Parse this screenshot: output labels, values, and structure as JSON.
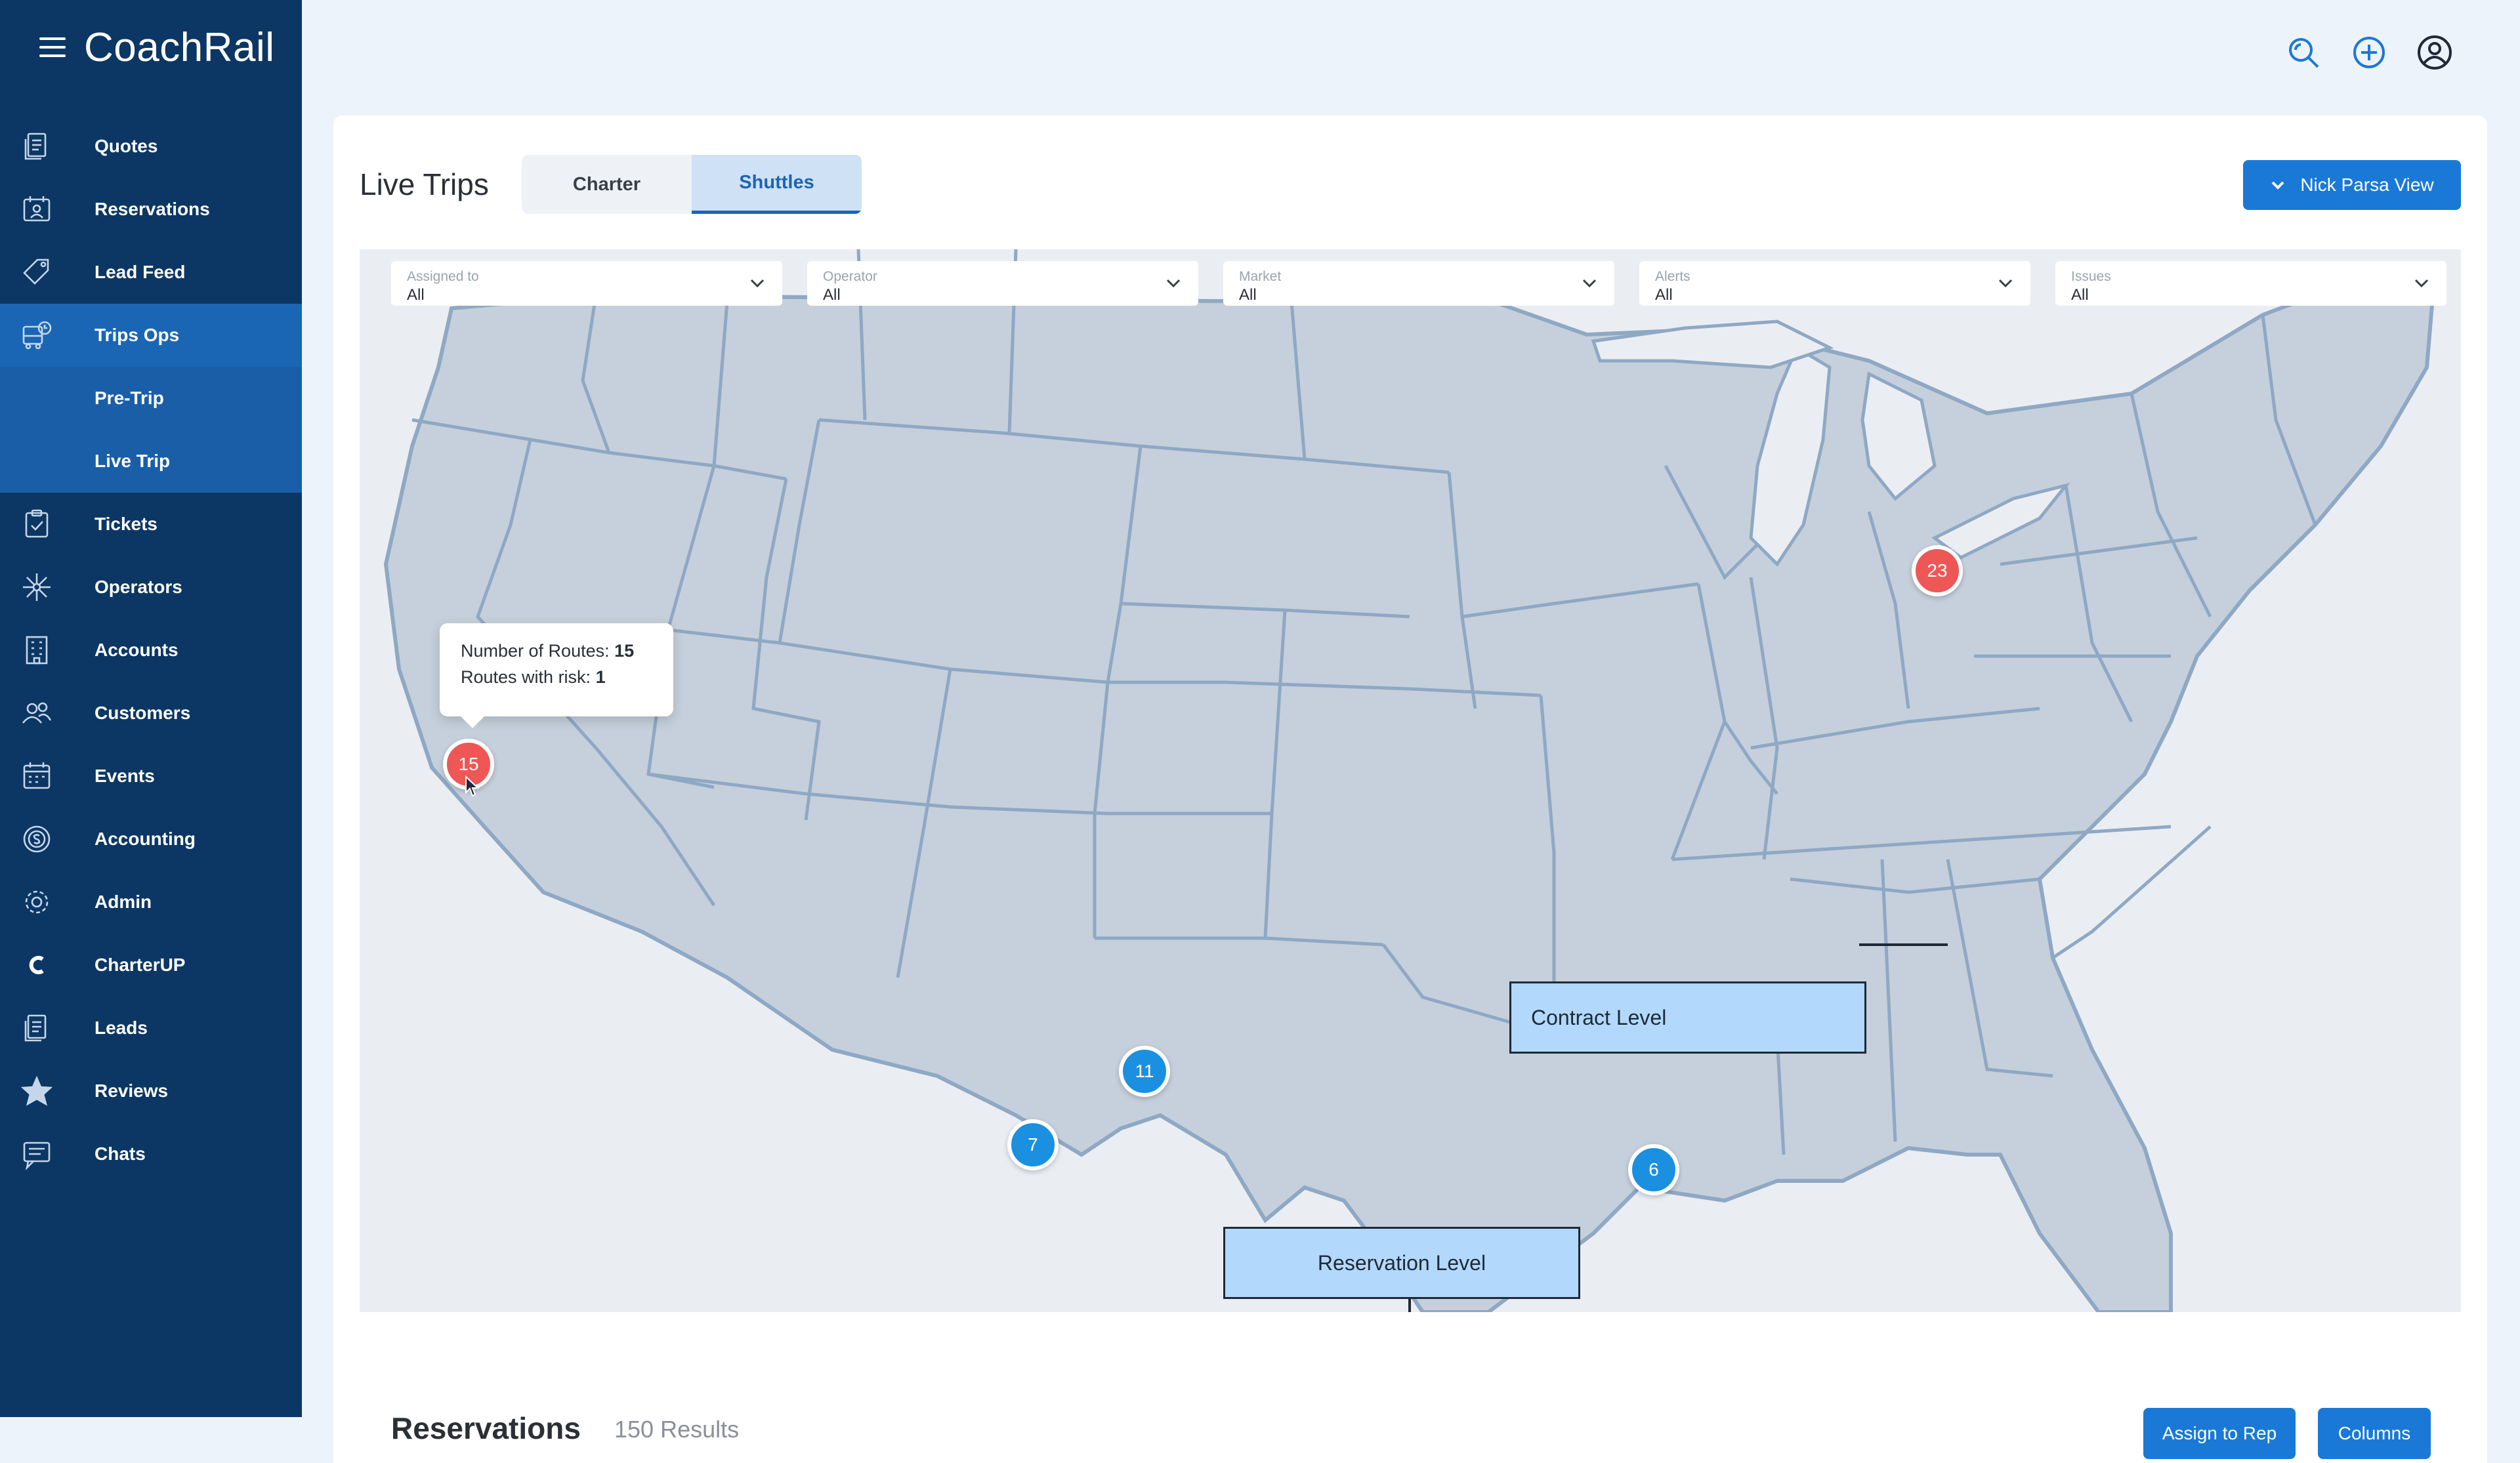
{
  "app": {
    "name": "CoachRail"
  },
  "sidebar": {
    "items": [
      {
        "label": "Quotes",
        "icon": "quote-icon"
      },
      {
        "label": "Reservations",
        "icon": "reservation-icon"
      },
      {
        "label": "Lead Feed",
        "icon": "tag-icon"
      },
      {
        "label": "Trips Ops",
        "icon": "bus-clock-icon",
        "active": true
      },
      {
        "label": "Pre-Trip",
        "sub": true
      },
      {
        "label": "Live Trip",
        "sub": true
      },
      {
        "label": "Tickets",
        "icon": "clipboard-check-icon"
      },
      {
        "label": "Operators",
        "icon": "network-icon"
      },
      {
        "label": "Accounts",
        "icon": "building-icon"
      },
      {
        "label": "Customers",
        "icon": "people-icon"
      },
      {
        "label": "Events",
        "icon": "calendar-icon"
      },
      {
        "label": "Accounting",
        "icon": "coin-icon"
      },
      {
        "label": "Admin",
        "icon": "gear-icon"
      },
      {
        "label": "CharterUP",
        "icon": "charterup-logo-icon"
      },
      {
        "label": "Leads",
        "icon": "document-icon"
      },
      {
        "label": "Reviews",
        "icon": "star-icon"
      },
      {
        "label": "Chats",
        "icon": "chat-icon"
      }
    ]
  },
  "header": {
    "icons": [
      "search-icon",
      "add-circle-icon",
      "user-avatar-icon"
    ]
  },
  "page": {
    "title": "Live Trips",
    "tabs": [
      {
        "label": "Charter"
      },
      {
        "label": "Shuttles",
        "active": true
      }
    ],
    "view_button": "Nick Parsa View"
  },
  "filters": [
    {
      "label": "Assigned to",
      "value": "All"
    },
    {
      "label": "Operator",
      "value": "All"
    },
    {
      "label": "Market",
      "value": "All"
    },
    {
      "label": "Alerts",
      "value": "All"
    },
    {
      "label": "Issues",
      "value": "All"
    }
  ],
  "map": {
    "markers": [
      {
        "value": "15",
        "status": "risk"
      },
      {
        "value": "23",
        "status": "risk"
      },
      {
        "value": "11",
        "status": "normal"
      },
      {
        "value": "7",
        "status": "normal"
      },
      {
        "value": "6",
        "status": "normal"
      }
    ],
    "tooltip": {
      "routes_label": "Number of Routes:",
      "routes_value": "15",
      "risk_label": "Routes with risk:",
      "risk_value": "1"
    },
    "callouts": {
      "contract": "Contract Level",
      "reservation": "Reservation Level"
    }
  },
  "reservations": {
    "title": "Reservations",
    "count": "150 Results",
    "assign_button": "Assign to Rep",
    "columns_button": "Columns"
  },
  "colors": {
    "sidebar": "#0c3764",
    "accent": "#1a79d6",
    "marker_risk": "#ef5656",
    "marker_normal": "#1b8fe0",
    "map_land": "#c5d0dc",
    "map_border": "#8fa8c4"
  }
}
